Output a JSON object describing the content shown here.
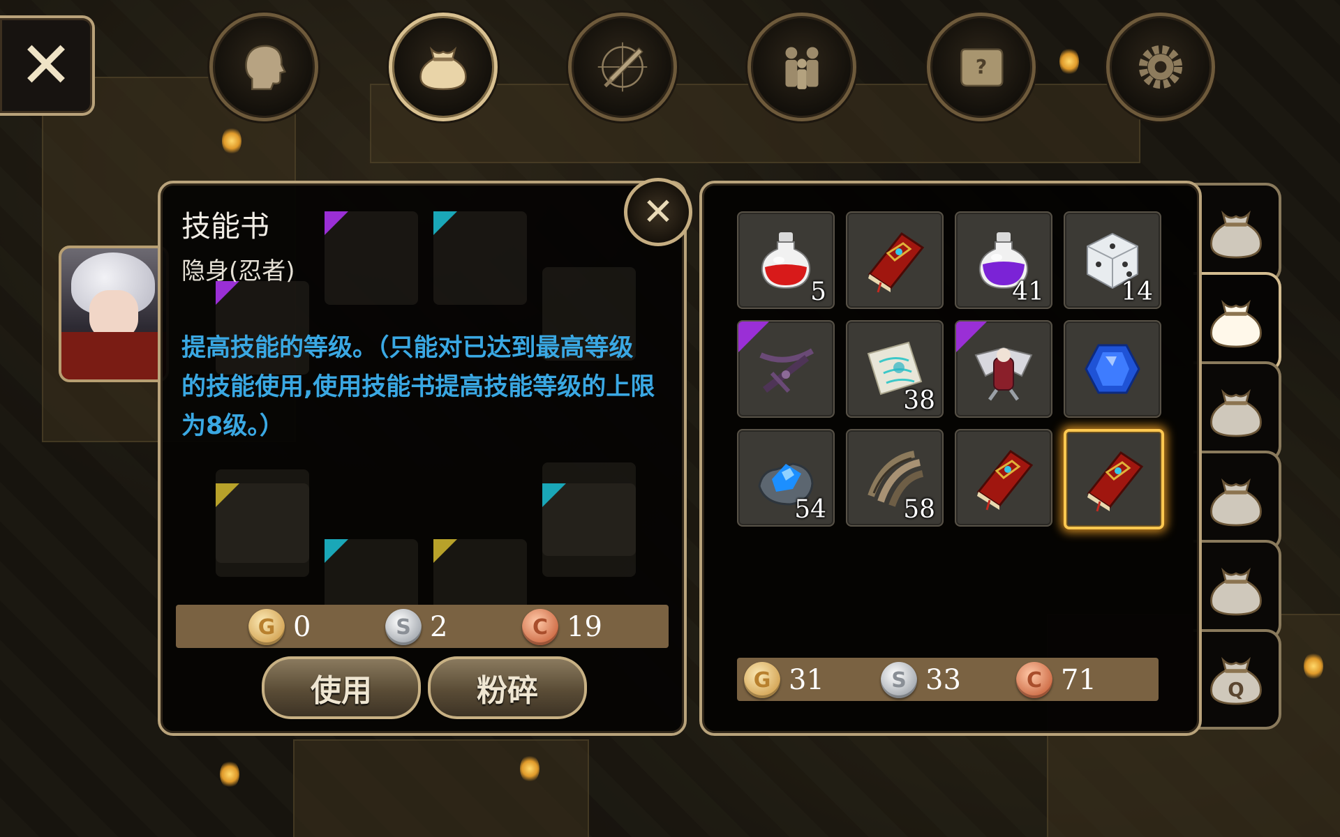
{
  "top_nav": {
    "buttons": [
      {
        "name": "character",
        "icon": "head-icon",
        "active": false
      },
      {
        "name": "inventory",
        "icon": "bag-icon",
        "active": true
      },
      {
        "name": "skills",
        "icon": "sword-compass-icon",
        "active": false
      },
      {
        "name": "party",
        "icon": "people-icon",
        "active": false
      },
      {
        "name": "quests",
        "icon": "scroll-icon",
        "active": false
      },
      {
        "name": "settings",
        "icon": "gear-icon",
        "active": false
      }
    ]
  },
  "item_detail": {
    "title": "技能书",
    "subtitle": "隐身(忍者)",
    "description": "提高技能的等级。（只能对已达到最高等级的技能使用,使用技能书提高技能等级的上限为8级。）",
    "currency": {
      "gold": "0",
      "silver": "2",
      "copper": "19"
    },
    "use_label": "使用",
    "smash_label": "粉碎"
  },
  "inventory": {
    "slots": [
      {
        "item": "red-potion",
        "qty": "5",
        "rarity": "",
        "selected": false
      },
      {
        "item": "red-skill-book",
        "qty": "",
        "rarity": "",
        "selected": false
      },
      {
        "item": "purple-potion",
        "qty": "41",
        "rarity": "",
        "selected": false
      },
      {
        "item": "white-dice",
        "qty": "14",
        "rarity": "",
        "selected": false
      },
      {
        "item": "dark-crossbow",
        "qty": "",
        "rarity": "epic",
        "selected": false
      },
      {
        "item": "map-scroll",
        "qty": "38",
        "rarity": "",
        "selected": false
      },
      {
        "item": "winged-armor",
        "qty": "",
        "rarity": "epic",
        "selected": false
      },
      {
        "item": "blue-gem",
        "qty": "",
        "rarity": "",
        "selected": false
      },
      {
        "item": "blue-ore",
        "qty": "54",
        "rarity": "",
        "selected": false
      },
      {
        "item": "claw-scrap",
        "qty": "58",
        "rarity": "",
        "selected": false
      },
      {
        "item": "red-skill-book",
        "qty": "",
        "rarity": "",
        "selected": false
      },
      {
        "item": "red-skill-book",
        "qty": "",
        "rarity": "",
        "selected": true
      }
    ],
    "currency": {
      "gold": "31",
      "silver": "33",
      "copper": "71"
    }
  },
  "bag_tabs": [
    {
      "name": "bag-1",
      "active": false,
      "label": ""
    },
    {
      "name": "bag-2",
      "active": true,
      "label": ""
    },
    {
      "name": "bag-3",
      "active": false,
      "label": ""
    },
    {
      "name": "bag-4",
      "active": false,
      "label": ""
    },
    {
      "name": "bag-5",
      "active": false,
      "label": ""
    },
    {
      "name": "quest-bag",
      "active": false,
      "label": "Q"
    }
  ],
  "coin_letters": {
    "gold": "G",
    "silver": "S",
    "copper": "C"
  },
  "colors": {
    "panel_border": "#b9a37b",
    "description_text": "#3aa8e3",
    "selected_glow": "#ffc850",
    "epic_rarity": "#9a2fd6"
  }
}
